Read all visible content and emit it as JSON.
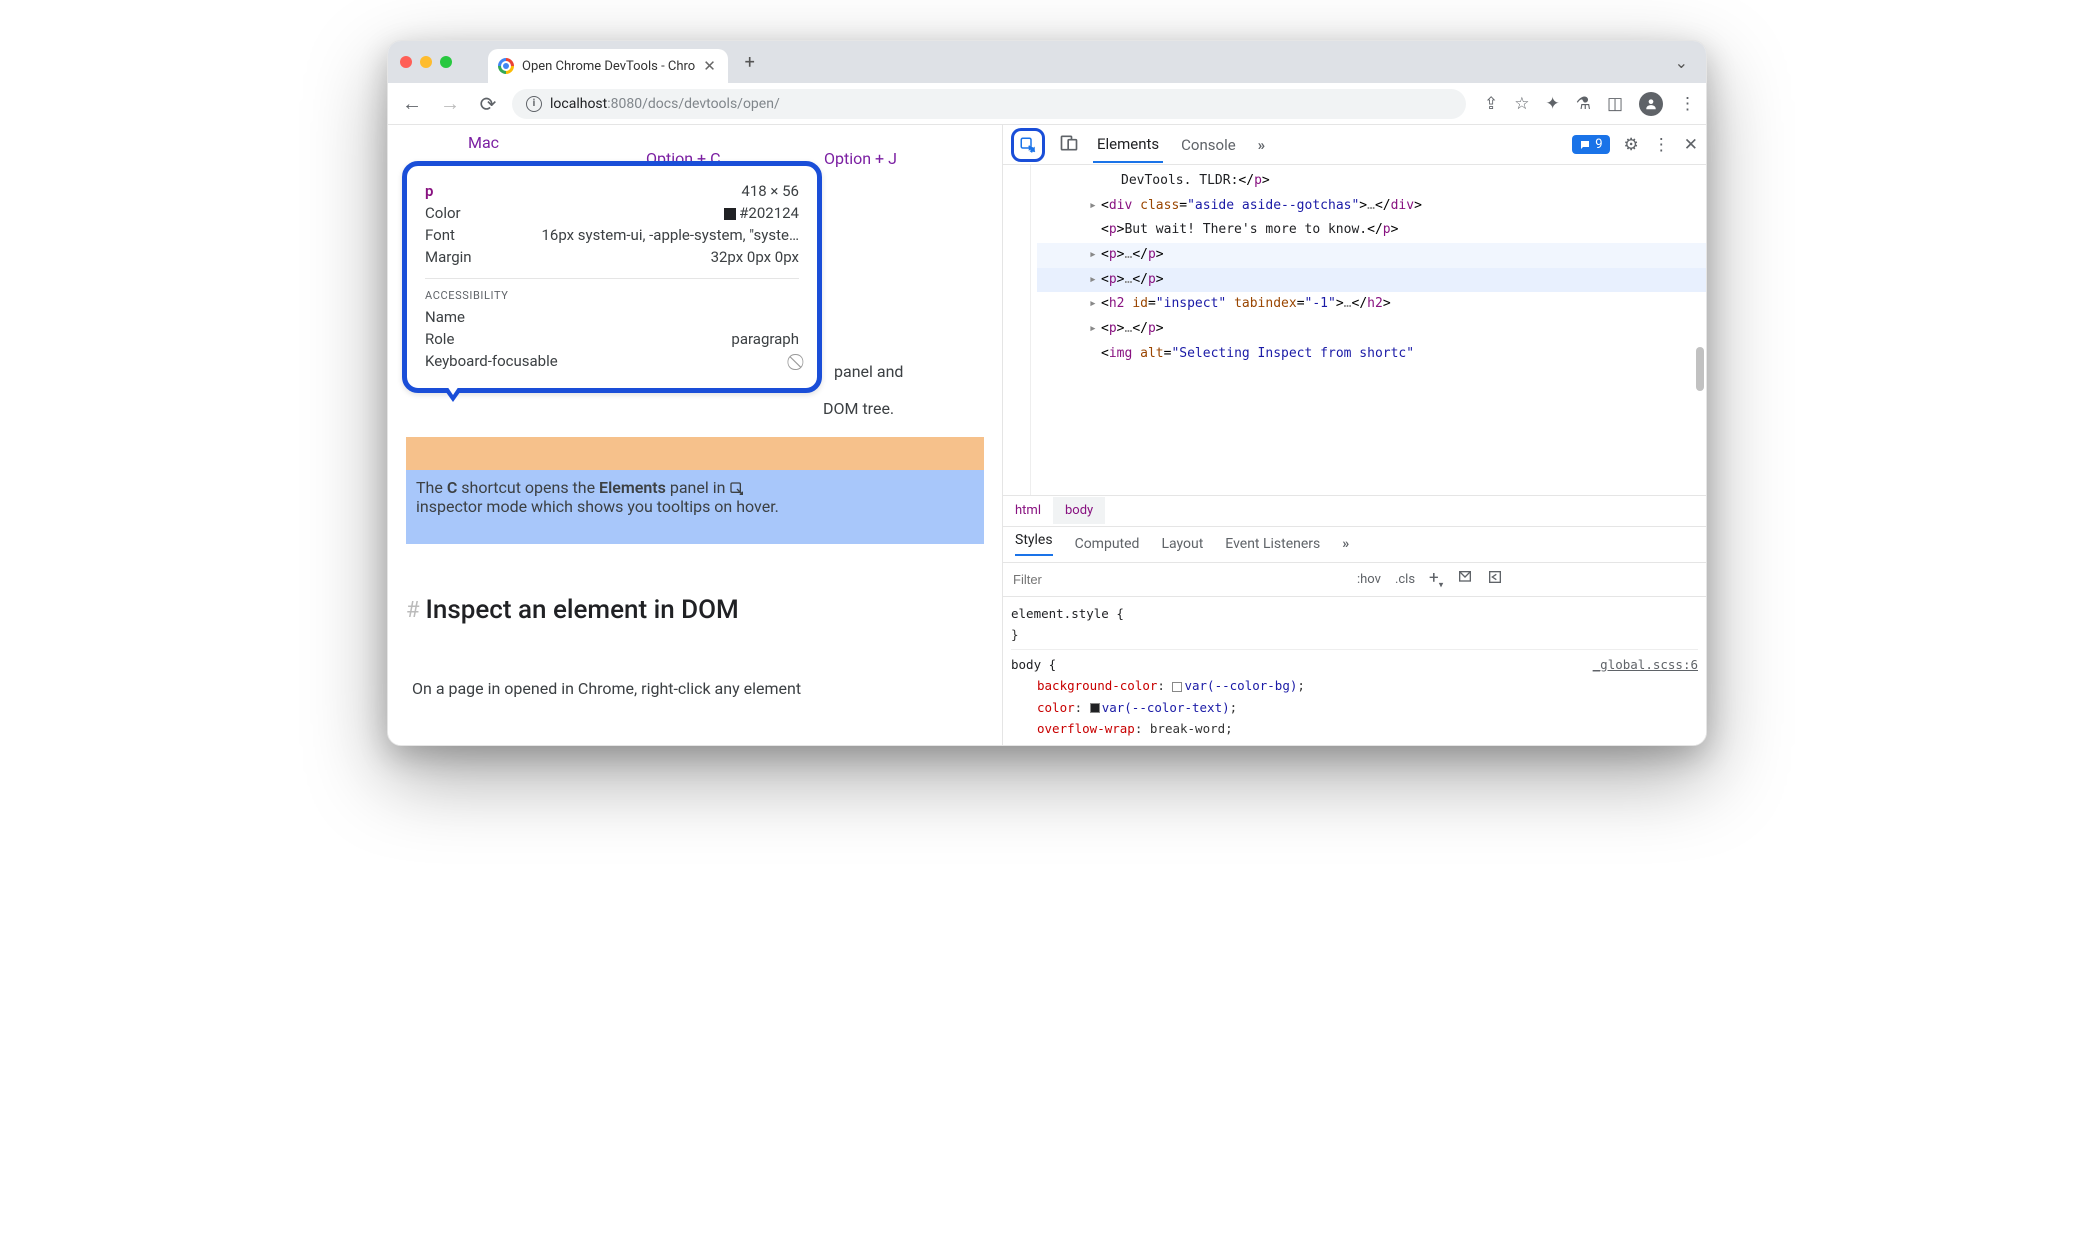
{
  "browser_tab": {
    "title": "Open Chrome DevTools - Chro",
    "url_host": "localhost",
    "url_port": ":8080",
    "url_path": "/docs/devtools/open/"
  },
  "page": {
    "mac_label": "Mac",
    "opt_c": "Option + C",
    "opt_j": "Option + J",
    "panel_fragment_1": "panel and",
    "panel_fragment_2": "DOM tree.",
    "highlight_line1_pre": "The ",
    "highlight_line1_c": "C",
    "highlight_line1_mid": " shortcut opens the ",
    "highlight_line1_elements": "Elements",
    "highlight_line1_post": " panel in ",
    "highlight_line2": "inspector mode which shows you tooltips on hover.",
    "heading": "Inspect an element in DOM",
    "body_text": "On a page in opened in Chrome, right-click any element"
  },
  "tooltip": {
    "tag_name": "p",
    "dimensions": "418 × 56",
    "color_label": "Color",
    "color_value": "#202124",
    "font_label": "Font",
    "font_value": "16px system-ui, -apple-system, \"syste…",
    "margin_label": "Margin",
    "margin_value": "32px 0px 0px",
    "a11y_header": "ACCESSIBILITY",
    "name_label": "Name",
    "role_label": "Role",
    "role_value": "paragraph",
    "kf_label": "Keyboard-focusable"
  },
  "devtools": {
    "tabs": {
      "elements": "Elements",
      "console": "Console"
    },
    "issues_count": "9",
    "breadcrumbs": {
      "html": "html",
      "body": "body"
    },
    "styles_tabs": {
      "styles": "Styles",
      "computed": "Computed",
      "layout": "Layout",
      "event": "Event Listeners"
    },
    "filter_placeholder": "Filter",
    "hov": ":hov",
    "cls": ".cls",
    "element_style": "element.style {",
    "close_brace": "}",
    "body_rule_sel": "body {",
    "body_rule_src": "_global.scss:6",
    "prop_bg": "background-color",
    "val_bg_var": "var(--color-bg)",
    "punct_colon": ": ",
    "punct_semi": ";",
    "prop_color": "color",
    "val_color_var": "var(--color-text)",
    "prop_wrap": "overflow-wrap",
    "val_wrap": "break-word"
  },
  "dom_tree": [
    {
      "indent": 1,
      "caret": false,
      "html": "DevTools. TLDR:</p>"
    },
    {
      "indent": 0,
      "caret": true,
      "html": "<div class=\"aside aside--gotchas\">…</div>"
    },
    {
      "indent": 0,
      "caret": false,
      "html": "<p>But wait! There's more to know.</p>"
    },
    {
      "indent": 0,
      "caret": true,
      "hl": "light",
      "html": "<p>…</p>"
    },
    {
      "indent": 0,
      "caret": true,
      "hl": "strong",
      "html": "<p>…</p>"
    },
    {
      "indent": 0,
      "caret": true,
      "html": "<h2 id=\"inspect\" tabindex=\"-1\">…</h2>"
    },
    {
      "indent": 0,
      "caret": true,
      "html": "<p>…</p>"
    },
    {
      "indent": 0,
      "caret": false,
      "html": "<img alt=\"Selecting Inspect from shortc"
    }
  ]
}
